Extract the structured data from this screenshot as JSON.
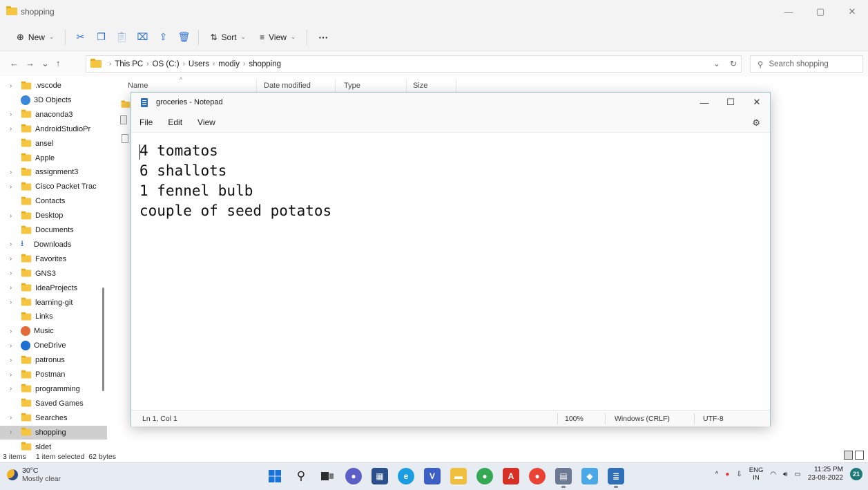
{
  "explorer": {
    "window_title": "shopping",
    "toolbar": {
      "new_label": "New",
      "sort_label": "Sort",
      "view_label": "View",
      "more_label": "···"
    },
    "address": {
      "crumbs": [
        "This PC",
        "OS (C:)",
        "Users",
        "modiy",
        "shopping"
      ]
    },
    "search_placeholder": "Search shopping",
    "columns": [
      "Name",
      "Date modified",
      "Type",
      "Size"
    ],
    "sidebar": [
      {
        "label": ".vscode",
        "chevron": true,
        "icon": "folder-icon"
      },
      {
        "label": "3D Objects",
        "chevron": false,
        "icon": "3d-objects-icon"
      },
      {
        "label": "anaconda3",
        "chevron": true,
        "icon": "folder-icon"
      },
      {
        "label": "AndroidStudioPr",
        "chevron": true,
        "icon": "folder-icon"
      },
      {
        "label": "ansel",
        "chevron": false,
        "icon": "folder-icon"
      },
      {
        "label": "Apple",
        "chevron": false,
        "icon": "folder-icon"
      },
      {
        "label": "assignment3",
        "chevron": true,
        "icon": "folder-icon"
      },
      {
        "label": "Cisco Packet Trac",
        "chevron": true,
        "icon": "folder-icon"
      },
      {
        "label": "Contacts",
        "chevron": false,
        "icon": "folder-icon"
      },
      {
        "label": "Desktop",
        "chevron": true,
        "icon": "folder-icon"
      },
      {
        "label": "Documents",
        "chevron": false,
        "icon": "folder-icon"
      },
      {
        "label": "Downloads",
        "chevron": true,
        "icon": "download-icon"
      },
      {
        "label": "Favorites",
        "chevron": true,
        "icon": "folder-icon"
      },
      {
        "label": "GNS3",
        "chevron": true,
        "icon": "folder-icon"
      },
      {
        "label": "IdeaProjects",
        "chevron": true,
        "icon": "folder-icon"
      },
      {
        "label": "learning-git",
        "chevron": true,
        "icon": "folder-icon"
      },
      {
        "label": "Links",
        "chevron": false,
        "icon": "folder-icon"
      },
      {
        "label": "Music",
        "chevron": true,
        "icon": "music-icon"
      },
      {
        "label": "OneDrive",
        "chevron": true,
        "icon": "onedrive-icon"
      },
      {
        "label": "patronus",
        "chevron": true,
        "icon": "folder-icon"
      },
      {
        "label": "Postman",
        "chevron": true,
        "icon": "folder-icon"
      },
      {
        "label": "programming",
        "chevron": true,
        "icon": "folder-icon"
      },
      {
        "label": "Saved Games",
        "chevron": false,
        "icon": "folder-icon"
      },
      {
        "label": "Searches",
        "chevron": true,
        "icon": "folder-icon"
      },
      {
        "label": "shopping",
        "chevron": true,
        "icon": "folder-icon",
        "selected": true
      },
      {
        "label": "sldet",
        "chevron": false,
        "icon": "folder-icon"
      }
    ],
    "status": {
      "items": "3 items",
      "selection": "1 item selected  62 bytes"
    }
  },
  "notepad": {
    "title": "groceries - Notepad",
    "menu": [
      "File",
      "Edit",
      "View"
    ],
    "lines": [
      "4 tomatos",
      "6 shallots",
      "1 fennel bulb",
      "couple of seed potatos"
    ],
    "status": {
      "position": "Ln 1, Col 1",
      "zoom": "100%",
      "line_ending": "Windows (CRLF)",
      "encoding": "UTF-8"
    }
  },
  "taskbar": {
    "weather_temp": "30°C",
    "weather_condition": "Mostly clear",
    "lang_top": "ENG",
    "lang_bottom": "IN",
    "time": "11:25 PM",
    "date": "23-08-2022",
    "notification_count": "21"
  },
  "colors": {
    "folder": "#f5c542",
    "accent": "#2f6fb8",
    "notepad_border": "#9ec7c4",
    "notification": "#1e7a78"
  }
}
